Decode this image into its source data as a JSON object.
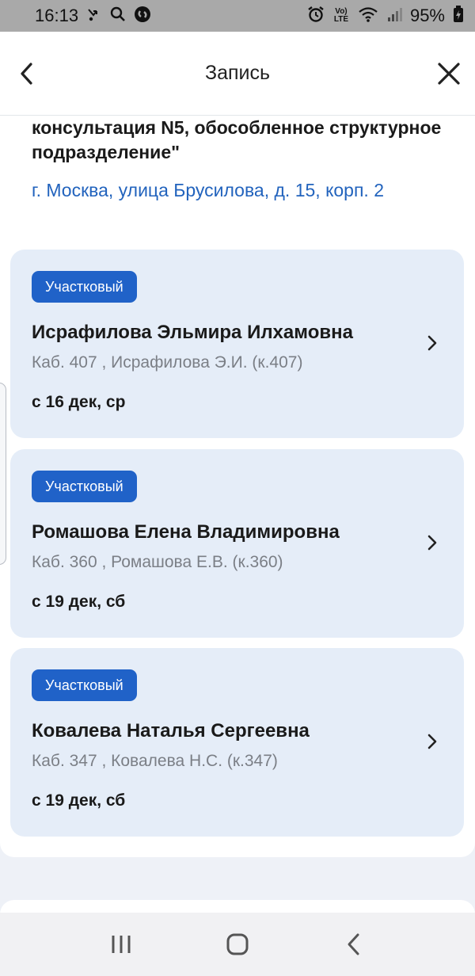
{
  "status_bar": {
    "time": "16:13",
    "battery": "95%",
    "left_icons": [
      "missed-call-icon",
      "search-icon",
      "shazam-icon"
    ],
    "right_icons": [
      "alarm-icon",
      "volte-icon",
      "wifi-icon",
      "signal-icon",
      "battery-charging-icon"
    ],
    "volte_text": "Vo) LTE"
  },
  "header": {
    "title": "Запись",
    "back_icon": "chevron-left-icon",
    "close_icon": "close-icon"
  },
  "clinic": {
    "name": "консультация N5, обособленное структурное подразделение\"",
    "address": "г. Москва, улица Брусилова, д. 15, корп. 2"
  },
  "doctors": [
    {
      "badge": "Участковый",
      "name": "Исрафилова Эльмира Илхамовна",
      "cabinet": "Каб. 407 , Исрафилова Э.И. (к.407)",
      "date": "с 16 дек, ср"
    },
    {
      "badge": "Участковый",
      "name": "Ромашова Елена Владимировна",
      "cabinet": "Каб. 360 , Ромашова Е.В. (к.360)",
      "date": "с 19 дек, сб"
    },
    {
      "badge": "Участковый",
      "name": "Ковалева Наталья Сергеевна",
      "cabinet": "Каб. 347 , Ковалева Н.С. (к.347)",
      "date": "с 19 дек, сб"
    }
  ],
  "colors": {
    "accent": "#2062c8",
    "link": "#2263bd",
    "card_bg": "#e5edf8",
    "page_bg": "#eef1f7"
  },
  "nav": {
    "icons": [
      "recent-apps-icon",
      "home-icon",
      "back-icon"
    ]
  }
}
